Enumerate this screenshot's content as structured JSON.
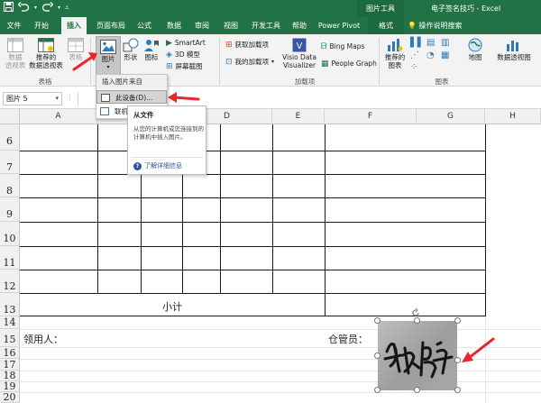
{
  "window": {
    "doc_title": "电子签名技巧 - Excel",
    "context_tab_group": "图片工具",
    "brand_color": "#217346"
  },
  "qat": {
    "save_icon": "save-icon",
    "undo_icon": "undo-icon",
    "redo_icon": "redo-icon",
    "customize_icon": "customize-qat-icon"
  },
  "tabs": [
    {
      "label": "文件"
    },
    {
      "label": "开始"
    },
    {
      "label": "插入",
      "active": true
    },
    {
      "label": "页面布局"
    },
    {
      "label": "公式"
    },
    {
      "label": "数据"
    },
    {
      "label": "审阅"
    },
    {
      "label": "视图"
    },
    {
      "label": "开发工具"
    },
    {
      "label": "帮助"
    },
    {
      "label": "Power Pivot"
    },
    {
      "label": "格式",
      "context": true
    }
  ],
  "search": {
    "label": "操作说明搜索"
  },
  "ribbon": {
    "pivottable": "数据\n透视表",
    "pivottable_l1": "数据",
    "pivottable_l2": "透视表",
    "recommended_pivot_l1": "推荐的",
    "recommended_pivot_l2": "数据透视表",
    "table": "表格",
    "group_tables": "表格",
    "pictures": "图片",
    "shapes": "形状",
    "icons": "图标",
    "smartart": "SmartArt",
    "model3d": "3D 模型",
    "screenshot": "屏幕截图",
    "get_addins": "获取加载项",
    "my_addins": "我的加载项",
    "visio_l1": "Visio Data",
    "visio_l2": "Visualizer",
    "bing_maps": "Bing Maps",
    "people_graph": "People Graph",
    "group_addins": "加载项",
    "rec_charts_l1": "推荐的",
    "rec_charts_l2": "图表",
    "maps": "地图",
    "pivot_chart": "数据透视图",
    "group_charts": "图表"
  },
  "formula_bar": {
    "name_box": "图片 5"
  },
  "columns": [
    "A",
    "B",
    "C",
    "D",
    "E",
    "F",
    "G",
    "H"
  ],
  "rows": [
    "6",
    "7",
    "8",
    "9",
    "10",
    "11",
    "12",
    "13",
    "14",
    "15",
    "16",
    "17",
    "18",
    "19",
    "20"
  ],
  "sheet": {
    "subtotal": "小计",
    "receiver_label": "领用人：",
    "keeper_label": "仓管员："
  },
  "dropdown": {
    "header": "插入图片来自",
    "item_device": "此设备(D)...",
    "item_online": "联机"
  },
  "tooltip": {
    "title": "从文件",
    "body": "从您的计算机或您连接到的计算机中插入图片。",
    "link": "了解详细信息"
  }
}
